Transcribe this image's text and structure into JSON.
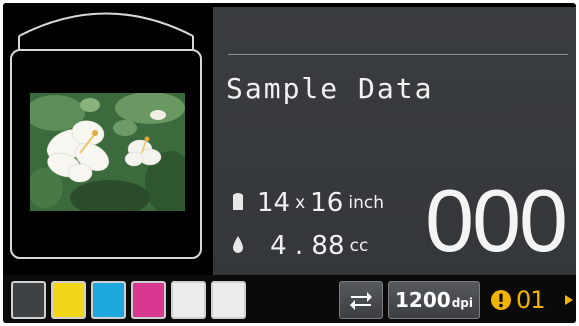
{
  "job": {
    "title": "Sample Data",
    "size_w": "14",
    "size_x": "x",
    "size_h": "16",
    "size_unit": "inch",
    "ink_amount": "4 . 88",
    "ink_unit": "cc",
    "counter": "000"
  },
  "ink_slots": [
    {
      "name": "black",
      "color": "#3f4245"
    },
    {
      "name": "yellow",
      "color": "#f3d51a"
    },
    {
      "name": "cyan",
      "color": "#1ea7dc"
    },
    {
      "name": "magenta",
      "color": "#d8388f"
    },
    {
      "name": "white",
      "color": "#ececec"
    },
    {
      "name": "white",
      "color": "#ececec"
    }
  ],
  "toolbar": {
    "swap_icon": "swap-arrows-icon",
    "resolution_value": "1200",
    "resolution_unit": "dpi",
    "alert_icon": "exclamation-circle-icon",
    "alert_count": "01",
    "next_icon": "triangle-right-icon"
  },
  "preview": {
    "image": "hibiscus-flower-photo"
  },
  "colors": {
    "accent": "#f2b300",
    "panel": "#3a3d40"
  }
}
